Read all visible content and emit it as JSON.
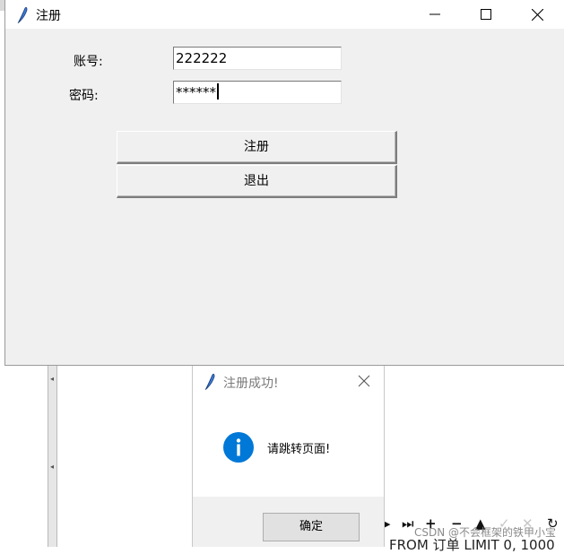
{
  "main_window": {
    "title": "注册",
    "form": {
      "account_label": "账号:",
      "account_value": "222222",
      "password_label": "密码:",
      "password_value": "******"
    },
    "buttons": {
      "register_label": "注册",
      "exit_label": "退出"
    }
  },
  "dialog": {
    "title": "注册成功!",
    "message": "请跳转页面!",
    "ok_label": "确定",
    "icon": "info-icon"
  },
  "background": {
    "sql_text": "FROM 订单 LIMIT 0, 1000",
    "watermark": "CSDN @不会框架的铁甲小宝"
  },
  "colors": {
    "info_blue": "#0078d7",
    "window_bg": "#f0f0f0"
  }
}
